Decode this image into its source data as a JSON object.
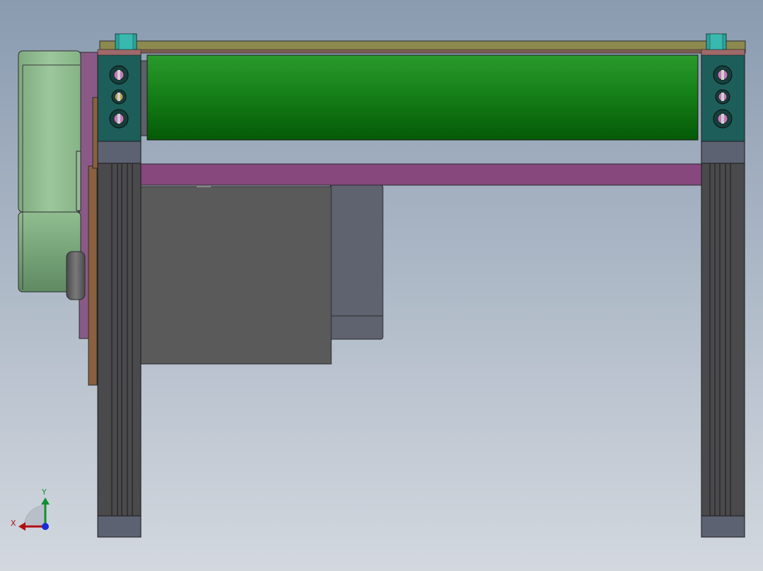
{
  "viewport": {
    "background_top": "#8a9bb0",
    "background_bottom": "#d3d8df"
  },
  "model": {
    "roller_color": "#1f8f22",
    "frame_leg_color": "#4a4a4c",
    "cross_beam_color": "#86487d",
    "top_rail_color": "#8c8a4e",
    "motor_color": "#8fbf8f",
    "bearing_block_color": "#1d5e5a",
    "fastener_color": "#2fa39a",
    "box_front_color": "#5a5a5a",
    "box_side_color": "#5f6370"
  },
  "triad": {
    "x_label": "X",
    "y_label": "Y",
    "x_color": "#b01010",
    "y_color": "#109030",
    "z_color": "#1a2cd8"
  }
}
